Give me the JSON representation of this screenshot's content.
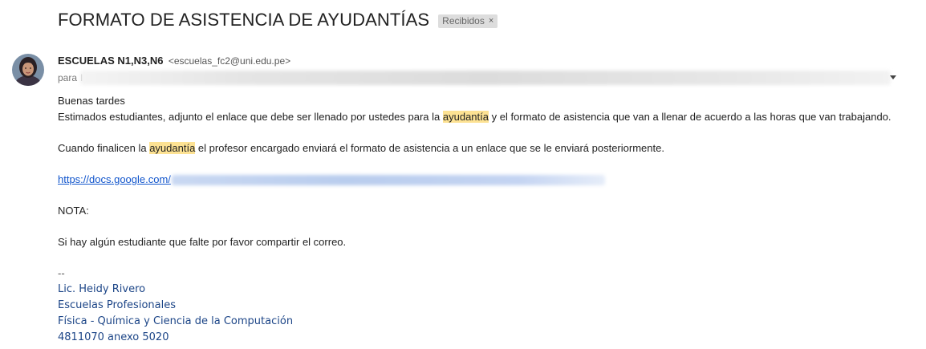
{
  "email": {
    "subject": "FORMATO DE ASISTENCIA DE AYUDANTÍAS",
    "label": "Recibidos",
    "label_close": "×",
    "sender": {
      "name": "ESCUELAS N1,N3,N6",
      "email": "<escuelas_fc2@uni.edu.pe>"
    },
    "to_label": "para",
    "to_prefix": "I"
  },
  "body": {
    "greeting": "Buenas tardes",
    "line1_a": "Estimados estudiantes, adjunto el enlace que debe ser llenado por ustedes para la ",
    "line1_highlight": "ayudantía",
    "line1_b": " y el formato de asistencia que van a llenar de acuerdo a las horas que van trabajando.",
    "line2_a": "Cuando finalicen la ",
    "line2_highlight": "ayudantía",
    "line2_b": " el profesor encargado enviará el formato de asistencia a un enlace que se le enviará posteriormente.",
    "link_text": "https://docs.google.com/",
    "nota": "NOTA:",
    "share_text": "Si hay algún estudiante que falte por favor compartir el correo."
  },
  "signature": {
    "dashes": "--",
    "name": "Lic. Heidy Rivero",
    "office": "Escuelas Profesionales",
    "schools": "Física - Química y Ciencia de la Computación",
    "phone": "4811070 anexo 5020"
  },
  "colors": {
    "highlight": "#fde293",
    "link": "#1155cc",
    "signature": "#1c4587"
  }
}
